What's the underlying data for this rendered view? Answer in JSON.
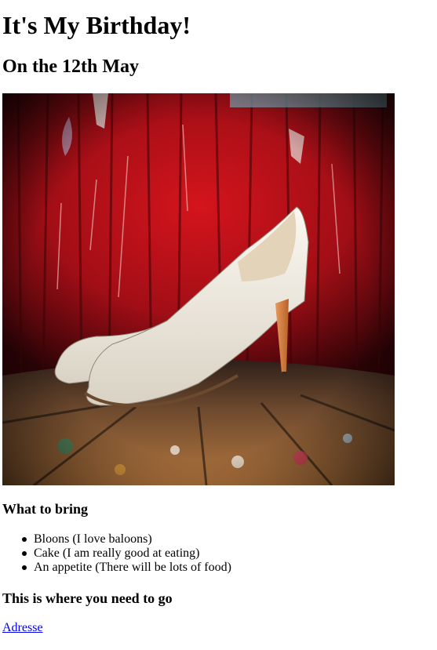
{
  "header": {
    "title": "It's My Birthday!",
    "subtitle": "On the 12th May"
  },
  "image": {
    "icon": "high-heel-shoes-photo"
  },
  "bring": {
    "heading": "What to bring",
    "items": [
      "Bloons (I love baloons)",
      "Cake (I am really good at eating)",
      "An appetite (There will be lots of food)"
    ]
  },
  "location": {
    "heading": "This is where you need to go",
    "link_label": "Adresse"
  },
  "colors": {
    "link": "#0000ee",
    "wall": "#b5121b",
    "shoe": "#f2ede4"
  }
}
